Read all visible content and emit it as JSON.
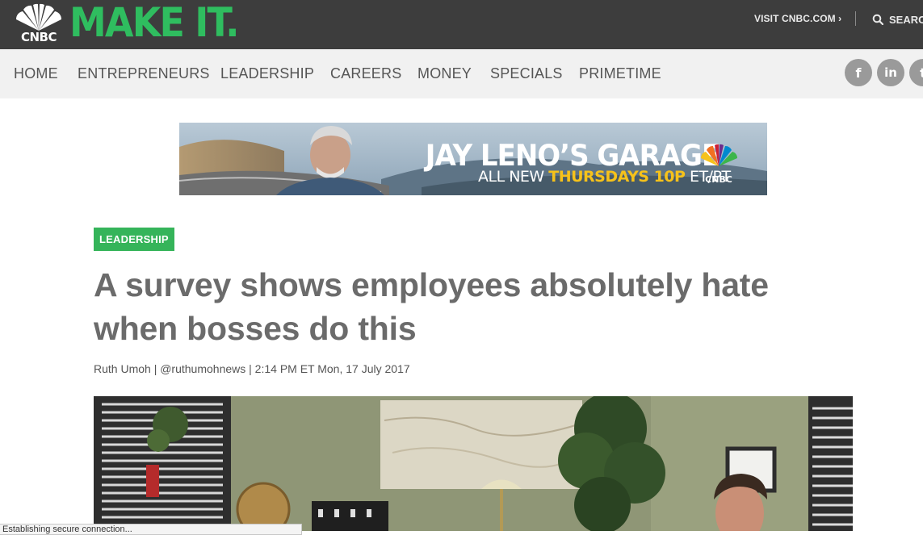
{
  "header": {
    "network_logo": "CNBC",
    "brand": "MAKE IT.",
    "visit_link": "VISIT CNBC.COM ›",
    "search_label": "SEARCH"
  },
  "nav": {
    "items": [
      "HOME",
      "ENTREPRENEURS",
      "LEADERSHIP",
      "CAREERS",
      "MONEY",
      "SPECIALS",
      "PRIMETIME"
    ],
    "social": {
      "facebook": "f",
      "linkedin": "in",
      "twitter": "t"
    }
  },
  "banner": {
    "title": "JAY LENO’S GARAGE",
    "tagline_prefix": "ALL NEW",
    "tagline_highlight": "THURSDAYS 10P",
    "tagline_suffix": "ET/PT",
    "network": "CNBC"
  },
  "article": {
    "tag": "LEADERSHIP",
    "headline": "A survey shows employees absolutely hate when bosses do this",
    "byline": "Ruth Umoh | @ruthumohnews | 2:14 PM ET Mon, 17 July 2017"
  },
  "status": {
    "text": "Establishing secure connection..."
  },
  "colors": {
    "header_bg": "#3d3d3d",
    "brand_green": "#2fbd5f",
    "nav_bg": "#f1f1f1",
    "tag_green": "#35b45a",
    "headline_gray": "#6b6b6b",
    "banner_yellow": "#f6c21a"
  },
  "icons": {
    "logo": "cnbc-peacock-icon",
    "search": "search-icon",
    "facebook": "facebook-icon",
    "linkedin": "linkedin-icon",
    "twitter": "twitter-icon"
  }
}
